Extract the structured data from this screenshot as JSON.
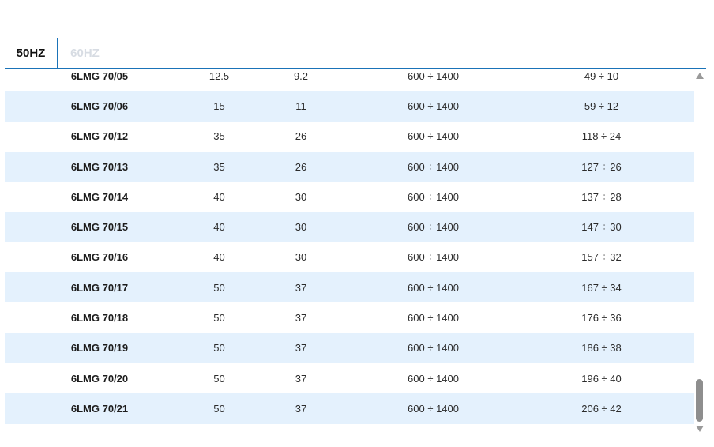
{
  "tabs": [
    {
      "label": "50HZ",
      "active": true
    },
    {
      "label": "60HZ",
      "active": false
    }
  ],
  "table": {
    "rows": [
      {
        "model": "6LMG 70/05",
        "kw": "12.5",
        "hp": "9.2",
        "range": "600 ÷ 1400",
        "head": "49 ÷ 10"
      },
      {
        "model": "6LMG 70/06",
        "kw": "15",
        "hp": "11",
        "range": "600 ÷ 1400",
        "head": "59 ÷ 12"
      },
      {
        "model": "6LMG 70/12",
        "kw": "35",
        "hp": "26",
        "range": "600 ÷ 1400",
        "head": "118 ÷ 24"
      },
      {
        "model": "6LMG 70/13",
        "kw": "35",
        "hp": "26",
        "range": "600 ÷ 1400",
        "head": "127 ÷ 26"
      },
      {
        "model": "6LMG 70/14",
        "kw": "40",
        "hp": "30",
        "range": "600 ÷ 1400",
        "head": "137 ÷ 28"
      },
      {
        "model": "6LMG 70/15",
        "kw": "40",
        "hp": "30",
        "range": "600 ÷ 1400",
        "head": "147 ÷ 30"
      },
      {
        "model": "6LMG 70/16",
        "kw": "40",
        "hp": "30",
        "range": "600 ÷ 1400",
        "head": "157 ÷ 32"
      },
      {
        "model": "6LMG 70/17",
        "kw": "50",
        "hp": "37",
        "range": "600 ÷ 1400",
        "head": "167 ÷ 34"
      },
      {
        "model": "6LMG 70/18",
        "kw": "50",
        "hp": "37",
        "range": "600 ÷ 1400",
        "head": "176 ÷ 36"
      },
      {
        "model": "6LMG 70/19",
        "kw": "50",
        "hp": "37",
        "range": "600 ÷ 1400",
        "head": "186 ÷ 38"
      },
      {
        "model": "6LMG 70/20",
        "kw": "50",
        "hp": "37",
        "range": "600 ÷ 1400",
        "head": "196 ÷ 40"
      },
      {
        "model": "6LMG 70/21",
        "kw": "50",
        "hp": "37",
        "range": "600 ÷ 1400",
        "head": "206 ÷ 42"
      }
    ]
  },
  "scrollbar": {
    "up_icon": "arrow-up-icon",
    "down_icon": "arrow-down-icon"
  },
  "colors": {
    "accent": "#1a73b8",
    "row_alt": "#e4f1fd",
    "inactive_tab": "#d7dce3"
  }
}
